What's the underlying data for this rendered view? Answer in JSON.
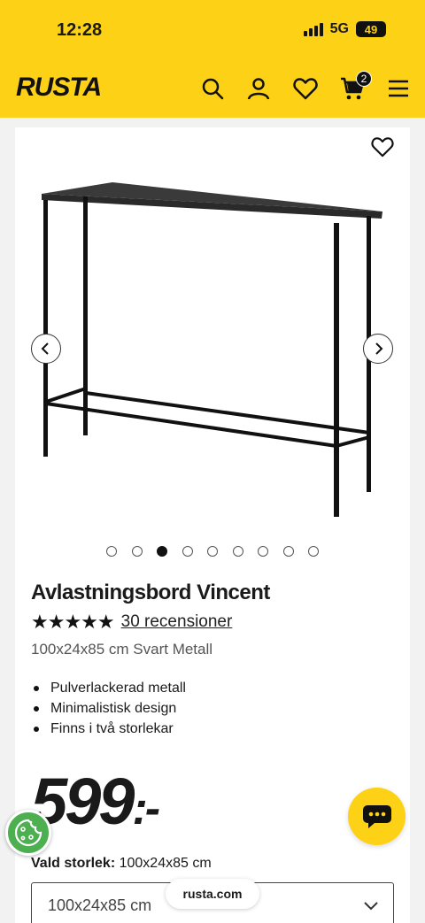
{
  "status_bar": {
    "time": "12:28",
    "network": "5G",
    "battery": "49"
  },
  "header": {
    "logo": "RUSTA",
    "cart_count": "2",
    "icons": [
      "search-icon",
      "user-icon",
      "heart-icon",
      "cart-icon",
      "menu-icon"
    ]
  },
  "gallery": {
    "image_count": 9,
    "active_index": 2
  },
  "product": {
    "title": "Avlastningsbord Vincent",
    "stars": "★★★★★",
    "rating": 5,
    "reviews_label": "30 recensioner",
    "variant": "100x24x85 cm Svart Metall",
    "features": [
      "Pulverlackerad metall",
      "Minimalistisk design",
      "Finns i två storlekar"
    ],
    "price": "599",
    "price_suffix": ":-"
  },
  "size": {
    "label": "Vald storlek:",
    "value": "100x24x85 cm",
    "select_value": "100x24x85 cm"
  },
  "browser": {
    "url": "rusta.com"
  },
  "colors": {
    "brand_yellow": "#fcd116",
    "cookie_green": "#4caf50",
    "text": "#1a1a1a"
  }
}
